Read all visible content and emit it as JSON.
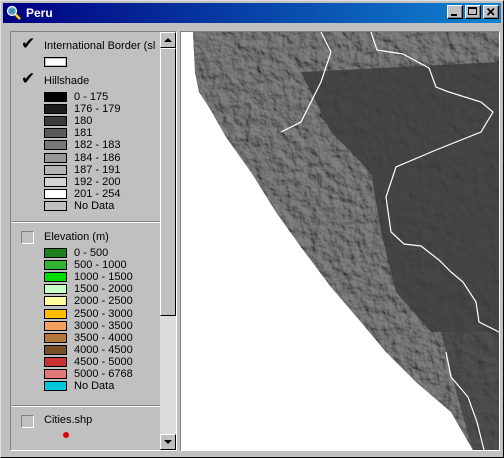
{
  "window": {
    "title": "Peru",
    "controls": {
      "minimize": "minimize",
      "maximize": "maximize",
      "close": "close"
    }
  },
  "toc": {
    "layers": [
      {
        "name": "International Border (sl",
        "visible": true,
        "legend": []
      },
      {
        "name": "Hillshade",
        "visible": true,
        "legend": [
          {
            "label": "0 - 175",
            "color": "#000000"
          },
          {
            "label": "176 - 179",
            "color": "#1c1c1c"
          },
          {
            "label": "180",
            "color": "#3a3a3a"
          },
          {
            "label": "181",
            "color": "#5a5a5a"
          },
          {
            "label": "182 - 183",
            "color": "#787878"
          },
          {
            "label": "184 - 186",
            "color": "#969696"
          },
          {
            "label": "187 - 191",
            "color": "#b4b4b4"
          },
          {
            "label": "192 - 200",
            "color": "#d4d4d4"
          },
          {
            "label": "201 - 254",
            "color": "#ffffff"
          },
          {
            "label": "No Data",
            "color": "#c0c0c0"
          }
        ]
      },
      {
        "name": "Elevation (m)",
        "visible": false,
        "legend": [
          {
            "label": "0 - 500",
            "color": "#1e7f1e"
          },
          {
            "label": "500 - 1000",
            "color": "#32b432"
          },
          {
            "label": "1000 - 1500",
            "color": "#00dc00"
          },
          {
            "label": "1500 - 2000",
            "color": "#c8ffc8"
          },
          {
            "label": "2000 - 2500",
            "color": "#ffff9c"
          },
          {
            "label": "2500 - 3000",
            "color": "#ffbe00"
          },
          {
            "label": "3000 - 3500",
            "color": "#f4a060"
          },
          {
            "label": "3500 - 4000",
            "color": "#b4783c"
          },
          {
            "label": "4000 - 4500",
            "color": "#784e26"
          },
          {
            "label": "4500 - 5000",
            "color": "#c83232"
          },
          {
            "label": "5000 - 6768",
            "color": "#e07878"
          },
          {
            "label": "No Data",
            "color": "#00c8dc"
          }
        ]
      },
      {
        "name": "Cities.shp",
        "visible": false,
        "symbol_color": "#e00000"
      }
    ]
  },
  "map": {
    "background": "#ffffff",
    "terrain_color": "#4a4a4a",
    "border_color": "#ffffff"
  }
}
